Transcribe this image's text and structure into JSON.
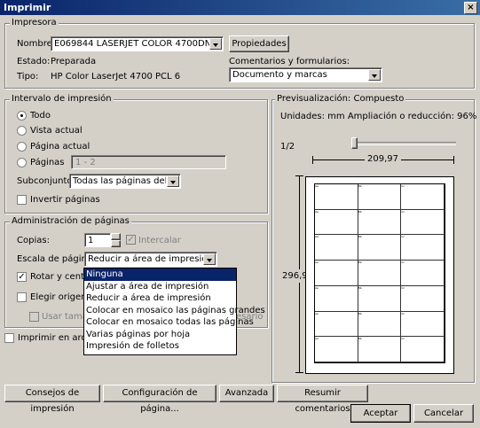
{
  "window": {
    "title": "Imprimir",
    "close": "×"
  },
  "printer": {
    "group": "Impresora",
    "name_label": "Nombre:",
    "name_value": "E069844 LASERJET COLOR 4700DN",
    "properties": "Propiedades",
    "status_label": "Estado:",
    "status_value": "Preparada",
    "type_label": "Tipo:",
    "type_value": "HP Color LaserJet 4700 PCL 6",
    "comments_label": "Comentarios y formularios:",
    "comments_value": "Documento y marcas"
  },
  "range": {
    "group": "Intervalo de impresión",
    "all": "Todo",
    "view": "Vista actual",
    "current": "Página actual",
    "pages": "Páginas",
    "pages_value": "1 - 2",
    "subset_label": "Subconjunto:",
    "subset_value": "Todas las páginas del inter",
    "reverse": "Invertir páginas"
  },
  "handling": {
    "group": "Administración de páginas",
    "copies_label": "Copias:",
    "copies_value": "1",
    "collate": "Intercalar",
    "scale_label": "Escala de página:",
    "scale_value": "Reducir a área de impresión",
    "rotate": "Rotar y centra",
    "choose_source": "Elegir origen de",
    "use_size": "Usar tamañ",
    "if_needed": "esario",
    "options": [
      "Ninguna",
      "Ajustar a área de impresión",
      "Reducir a área de impresión",
      "Colocar en mosaico las páginas grandes",
      "Colocar en mosaico todas las páginas",
      "Varias páginas por hoja",
      "Impresión de folletos"
    ]
  },
  "print_to_file": "Imprimir en archiv",
  "preview": {
    "group": "Previsualización: Compuesto",
    "units": "Unidades: mm Ampliación o reducción:  96%",
    "page": "1/2",
    "width": "209,97",
    "height": "296,97",
    "cell_texts": [
      "Aa",
      "Bb",
      "Cc"
    ]
  },
  "buttons": {
    "tips": "Consejos de impresión",
    "page_setup": "Configuración de página...",
    "advanced": "Avanzada",
    "summarize": "Resumir comentarios",
    "ok": "Aceptar",
    "cancel": "Cancelar"
  }
}
